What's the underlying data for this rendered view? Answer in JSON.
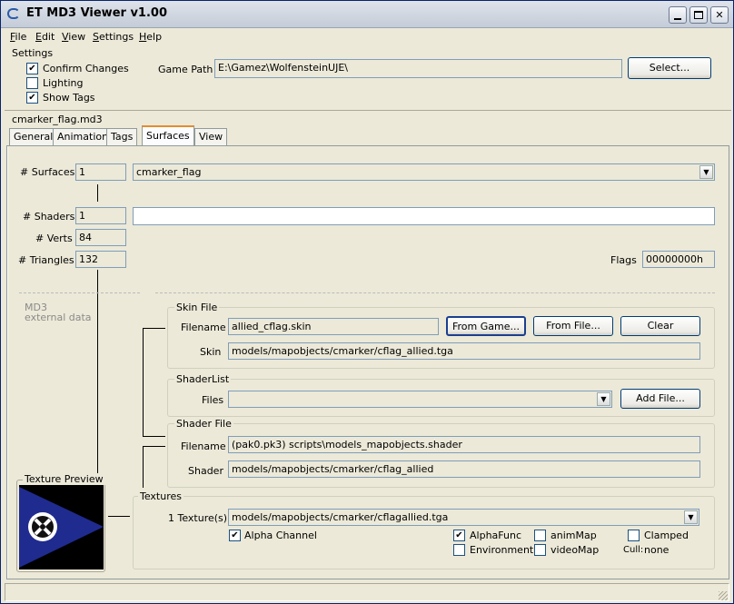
{
  "window": {
    "title": "ET MD3 Viewer v1.00"
  },
  "menu": [
    {
      "label": "File",
      "key": "F"
    },
    {
      "label": "Edit",
      "key": "E"
    },
    {
      "label": "View",
      "key": "V"
    },
    {
      "label": "Settings",
      "key": "S"
    },
    {
      "label": "Help",
      "key": "H"
    }
  ],
  "settings": {
    "title": "Settings",
    "confirm_changes": "Confirm Changes",
    "confirm_checked": "✔",
    "lighting": "Lighting",
    "lighting_checked": "",
    "show_tags": "Show Tags",
    "show_tags_checked": "✔",
    "game_path_label": "Game Path",
    "game_path_value": "E:\\Gamez\\WolfensteinUJE\\",
    "select_button": "Select..."
  },
  "file_label": "cmarker_flag.md3",
  "tabs": [
    "General",
    "Animation",
    "Tags",
    "Surfaces",
    "View"
  ],
  "surfaces": {
    "surfaces_label": "# Surfaces",
    "surfaces_value": "1",
    "surface_selected": "cmarker_flag",
    "shaders_label": "# Shaders",
    "shaders_value": "1",
    "shader_name": "",
    "verts_label": "# Verts",
    "verts_value": "84",
    "triangles_label": "# Triangles",
    "triangles_value": "132",
    "flags_label": "Flags",
    "flags_value": "00000000h",
    "md3_label": "MD3",
    "external_label": "external data"
  },
  "skin_file": {
    "title": "Skin File",
    "filename_label": "Filename",
    "filename_value": "allied_cflag.skin",
    "from_game": "From Game...",
    "from_file": "From File...",
    "clear": "Clear",
    "skin_label": "Skin",
    "skin_value": "models/mapobjects/cmarker/cflag_allied.tga"
  },
  "shader_list": {
    "title": "ShaderList",
    "files_label": "Files",
    "files_value": "",
    "add_file": "Add File..."
  },
  "shader_file": {
    "title": "Shader File",
    "filename_label": "Filename",
    "filename_value": "(pak0.pk3) scripts\\models_mapobjects.shader",
    "shader_label": "Shader",
    "shader_value": "models/mapobjects/cmarker/cflag_allied"
  },
  "texture_preview": {
    "title": "Texture Preview"
  },
  "textures": {
    "title": "Textures",
    "count_label": "1 Texture(s)",
    "texture_value": "models/mapobjects/cmarker/cflagallied.tga",
    "alpha_channel": "Alpha Channel",
    "alpha_channel_checked": "✔",
    "alphafunc": "AlphaFunc",
    "alphafunc_checked": "✔",
    "animmap": "animMap",
    "clamped": "Clamped",
    "environment": "Environment",
    "videomap": "videoMap",
    "cull_label": "Cull:",
    "cull_value": "none"
  },
  "colors": {
    "preview_bg": "#000000",
    "flag": "#1f2b8f"
  }
}
